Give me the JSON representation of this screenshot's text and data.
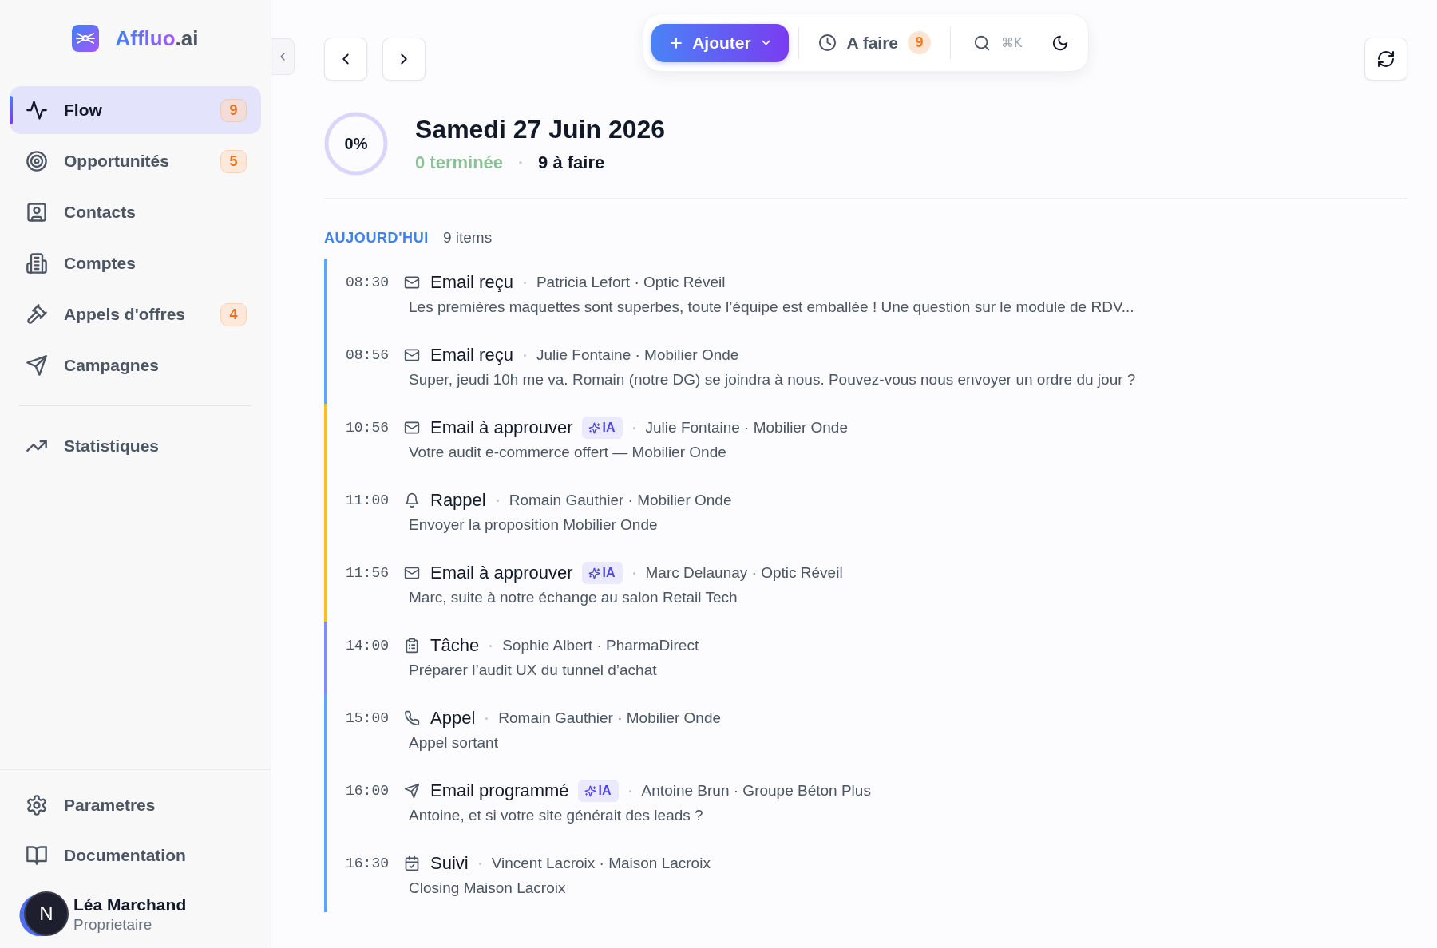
{
  "sidebar": {
    "logo": {
      "brand": "Affluo",
      "suffix": ".ai"
    },
    "nav_items": [
      {
        "label": "Flow",
        "badge": "9",
        "selected": true
      },
      {
        "label": "Opportunités",
        "badge": "5",
        "selected": false
      },
      {
        "label": "Contacts",
        "selected": false
      },
      {
        "label": "Comptes",
        "selected": false
      },
      {
        "label": "Appels d'offres",
        "badge": "4",
        "selected": false
      },
      {
        "label": "Campagnes",
        "selected": false
      }
    ],
    "secondary_items": [
      {
        "label": "Statistiques",
        "selected": false
      }
    ],
    "footer_items": [
      {
        "label": "Parametres",
        "selected": false
      },
      {
        "label": "Documentation",
        "selected": false
      }
    ],
    "user": {
      "initial": "N",
      "name": "Léa Marchand",
      "role": "Proprietaire"
    }
  },
  "toolbar": {
    "add_button": "Ajouter",
    "todo": {
      "label": "A faire",
      "count": "9"
    },
    "search": {
      "shortcut": "⌘K"
    }
  },
  "day": {
    "progress": {
      "label": "0%",
      "level": 0
    },
    "title": "Samedi 27 Juin 2026",
    "done": "0 terminée",
    "todo": "9 à faire"
  },
  "timeline": {
    "heading": "AUJOURD'HUI",
    "count": "9 items",
    "items": [
      {
        "time": "08:30",
        "kind": "email",
        "title": "Email reçu",
        "contact": "Patricia Lefort · Optic Réveil",
        "summary": "Les premières maquettes sont superbes, toute l’équipe est emballée ! Une question sur le module de RDV...",
        "color": "#60a5fa"
      },
      {
        "time": "08:56",
        "kind": "email",
        "title": "Email reçu",
        "contact": "Julie Fontaine · Mobilier Onde",
        "summary": "Super, jeudi 10h me va. Romain (notre DG) se joindra à nous. Pouvez-vous nous envoyer un ordre du jour ?",
        "color": "#60a5fa"
      },
      {
        "time": "10:56",
        "kind": "email",
        "title": "Email à approuver",
        "badge": "IA",
        "contact": "Julie Fontaine · Mobilier Onde",
        "summary": "Votre audit e-commerce offert — Mobilier Onde",
        "color": "#fbbf24"
      },
      {
        "time": "11:00",
        "kind": "reminder",
        "title": "Rappel",
        "contact": "Romain Gauthier · Mobilier Onde",
        "summary": "Envoyer la proposition Mobilier Onde",
        "color": "#fbbf24"
      },
      {
        "time": "11:56",
        "kind": "email",
        "title": "Email à approuver",
        "badge": "IA",
        "contact": "Marc Delaunay · Optic Réveil",
        "summary": "Marc, suite à notre échange au salon Retail Tech",
        "color": "#fbbf24"
      },
      {
        "time": "14:00",
        "kind": "task",
        "title": "Tâche",
        "contact": "Sophie Albert · PharmaDirect",
        "summary": "Préparer l’audit UX du tunnel d’achat",
        "color": "#818cf8"
      },
      {
        "time": "15:00",
        "kind": "call",
        "title": "Appel",
        "contact": "Romain Gauthier · Mobilier Onde",
        "summary": "Appel sortant",
        "color": "#60a5fa"
      },
      {
        "time": "16:00",
        "kind": "scheduled_email",
        "title": "Email programmé",
        "badge": "IA",
        "contact": "Antoine Brun · Groupe Béton Plus",
        "summary": "Antoine, et si votre site générait des leads ?",
        "color": "#60a5fa"
      },
      {
        "time": "16:30",
        "kind": "follow_up",
        "title": "Suivi",
        "contact": "Vincent Lacroix · Maison Lacroix",
        "summary": "Closing Maison Lacroix",
        "color": "#60a5fa"
      }
    ]
  }
}
